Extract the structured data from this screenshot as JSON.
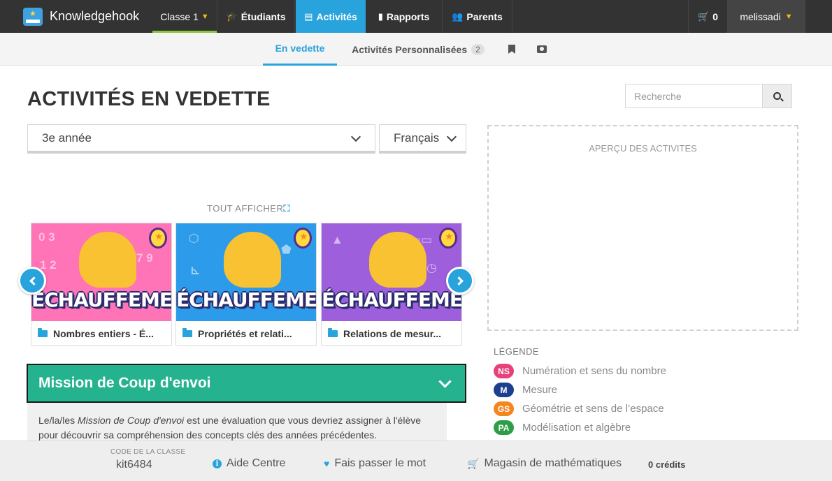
{
  "app": {
    "name": "Knowledgehook"
  },
  "topnav": {
    "classe": "Classe 1",
    "etudiants": "Étudiants",
    "activites": "Activités",
    "rapports": "Rapports",
    "parents": "Parents",
    "cart_count": "0",
    "user": "melissadi"
  },
  "subnav": {
    "vedette": "En vedette",
    "perso": "Activités Personnalisées",
    "perso_count": "2"
  },
  "page": {
    "title": "ACTIVITÉS EN VEDETTE"
  },
  "search": {
    "placeholder": "Recherche"
  },
  "filters": {
    "grade": "3e année",
    "language": "Français"
  },
  "carousel": {
    "show_all": "TOUT AFFICHER",
    "cards": [
      {
        "word": "ÉCHAUFFEMENTS",
        "label": "Nombres entiers - É..."
      },
      {
        "word": "ÉCHAUFFEMENTS",
        "label": "Propriétés et relati..."
      },
      {
        "word": "ÉCHAUFFEMENTS",
        "label": "Relations de mesur..."
      }
    ]
  },
  "mission": {
    "title": "Mission de Coup d'envoi",
    "desc_pre": "Le/la/les ",
    "desc_em": "Mission de Coup d'envoi",
    "desc_post": " est une évaluation que vous devriez assigner à l'élève pour découvrir sa compréhension des concepts clés des années précédentes."
  },
  "preview": {
    "title": "APERÇU DES ACTIVITES"
  },
  "legend": {
    "title": "LÉGENDE",
    "items": [
      {
        "code": "NS",
        "label": "Numération et sens du nombre",
        "color": "#e8407a"
      },
      {
        "code": "M",
        "label": "Mesure",
        "color": "#1d3f8f"
      },
      {
        "code": "GS",
        "label": "Géométrie et sens de l’espace",
        "color": "#f5851f"
      },
      {
        "code": "PA",
        "label": "Modélisation et algèbre",
        "color": "#2e9e46"
      }
    ]
  },
  "footer": {
    "code_label": "CODE DE LA CLASSE",
    "code_value": "kit6484",
    "help": "Aide Centre",
    "share": "Fais passer le mot",
    "store": "Magasin de mathématiques",
    "credits": "0 crédits"
  },
  "colors": {
    "accent": "#29a3dc",
    "mission": "#25b38f",
    "topbar": "#333333"
  }
}
